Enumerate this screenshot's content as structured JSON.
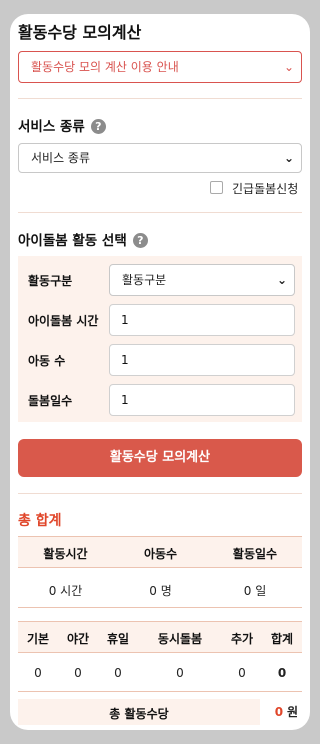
{
  "title": "활동수당 모의계산",
  "guide_select": "활동수당 모의 계산 이용 안내",
  "service": {
    "label": "서비스 종류",
    "select_value": "서비스 종류",
    "urgent_label": "긴급돌봄신청"
  },
  "activity": {
    "label": "아이돌봄 활동 선택",
    "rows": {
      "type": {
        "label": "활동구분",
        "value": "활동구분"
      },
      "hours": {
        "label": "아이돌봄 시간",
        "value": "1"
      },
      "children": {
        "label": "아동 수",
        "value": "1"
      },
      "days": {
        "label": "돌봄일수",
        "value": "1"
      }
    }
  },
  "calc_button": "활동수당 모의계산",
  "total": {
    "title": "총 합계",
    "summary_headers": [
      "활동시간",
      "아동수",
      "활동일수"
    ],
    "summary_values": [
      "0 시간",
      "0 명",
      "0 일"
    ],
    "detail_headers": [
      "기본",
      "야간",
      "휴일",
      "동시돌봄",
      "추가",
      "합계"
    ],
    "detail_values": [
      "0",
      "0",
      "0",
      "0",
      "0",
      "0"
    ],
    "footer_label": "총 활동수당",
    "footer_amount": "0",
    "footer_unit": "원"
  },
  "colors": {
    "accent": "#d9594b",
    "accent_text": "#e0462a",
    "tint": "#fdf2ec"
  },
  "icons": [
    "help-icon",
    "chevron-down-icon"
  ]
}
